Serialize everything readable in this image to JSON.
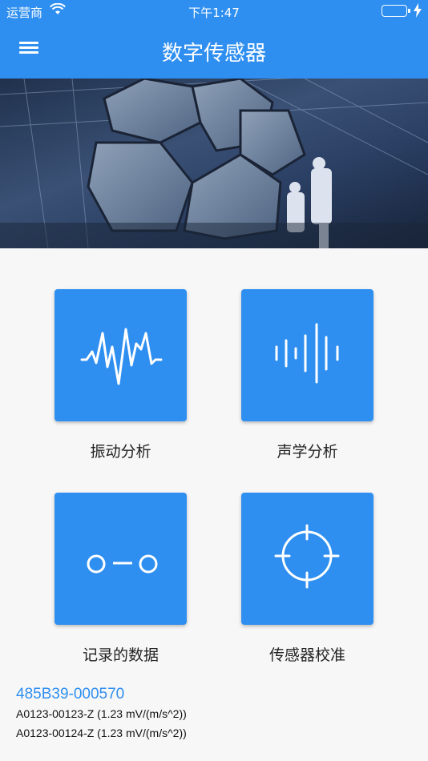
{
  "status_bar": {
    "carrier": "运营商",
    "time": "下午1:47"
  },
  "app_bar": {
    "title": "数字传感器"
  },
  "tiles": [
    {
      "label": "振动分析",
      "icon": "waveform-icon"
    },
    {
      "label": "声学分析",
      "icon": "sound-bars-icon"
    },
    {
      "label": "记录的数据",
      "icon": "conveyor-icon"
    },
    {
      "label": "传感器校准",
      "icon": "crosshair-icon"
    }
  ],
  "sensor": {
    "id": "485B39-000570",
    "channels": [
      "A0123-00123-Z (1.23 mV/(m/s^2))",
      "A0123-00124-Z (1.23 mV/(m/s^2))"
    ]
  },
  "colors": {
    "primary": "#2f8ff0",
    "background": "#f7f7f7"
  }
}
